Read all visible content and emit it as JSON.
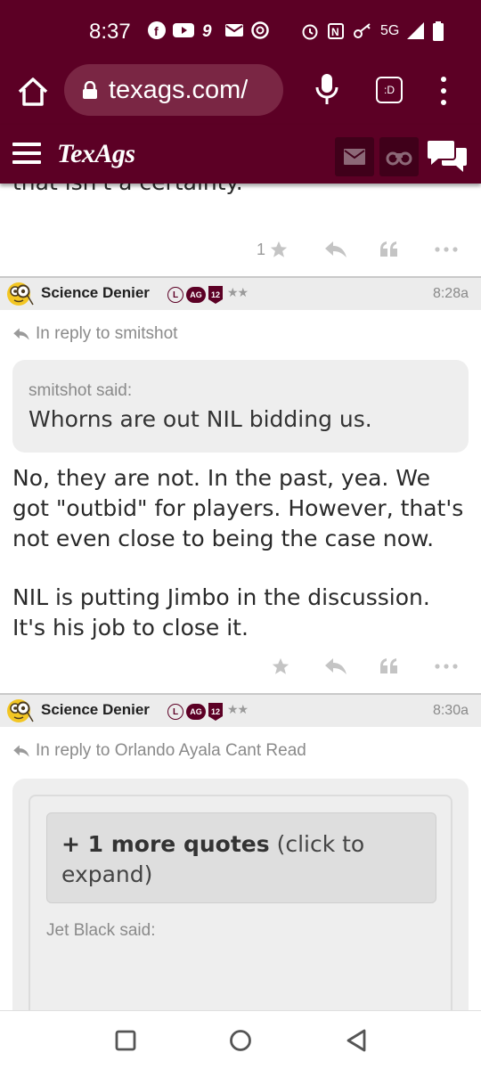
{
  "status_bar": {
    "time": "8:37",
    "network": "5G",
    "icons_left": [
      "facebook-icon",
      "youtube-icon",
      "nine-icon",
      "mail-icon",
      "chrome-icon"
    ],
    "icons_right": [
      "alarm-icon",
      "nfc-icon",
      "key-icon",
      "network-5g-icon",
      "signal-icon",
      "battery-icon"
    ]
  },
  "browser": {
    "url": "texags.com/",
    "tab_switcher_label": ":D"
  },
  "site": {
    "logo": "TexAgs",
    "brand_color": "#5c0025"
  },
  "previous_post": {
    "cut_text": "that isn't a certainty.",
    "like_count": "1"
  },
  "posts": [
    {
      "username": "Science Denier",
      "badge_l": "L",
      "badge_ag": "AG",
      "badge_year": "12",
      "stars": "★★",
      "time": "8:28a",
      "reply_to": "In reply to smitshot",
      "quote_author": "smitshot said:",
      "quote_text": "Whorns are out NIL bidding us.",
      "body": [
        "No, they are not. In the past, yea. We got \"outbid\" for players. However, that's not even close to being the case now.",
        "NIL is putting Jimbo in the discussion. It's his job to close it."
      ]
    },
    {
      "username": "Science Denier",
      "badge_l": "L",
      "badge_ag": "AG",
      "badge_year": "12",
      "stars": "★★",
      "time": "8:30a",
      "reply_to": "In reply to Orlando Ayala Cant Read",
      "more_quotes_bold": "+ 1 more quotes",
      "more_quotes_rest": " (click to expand)",
      "quote_author": "Jet Black said:"
    }
  ]
}
